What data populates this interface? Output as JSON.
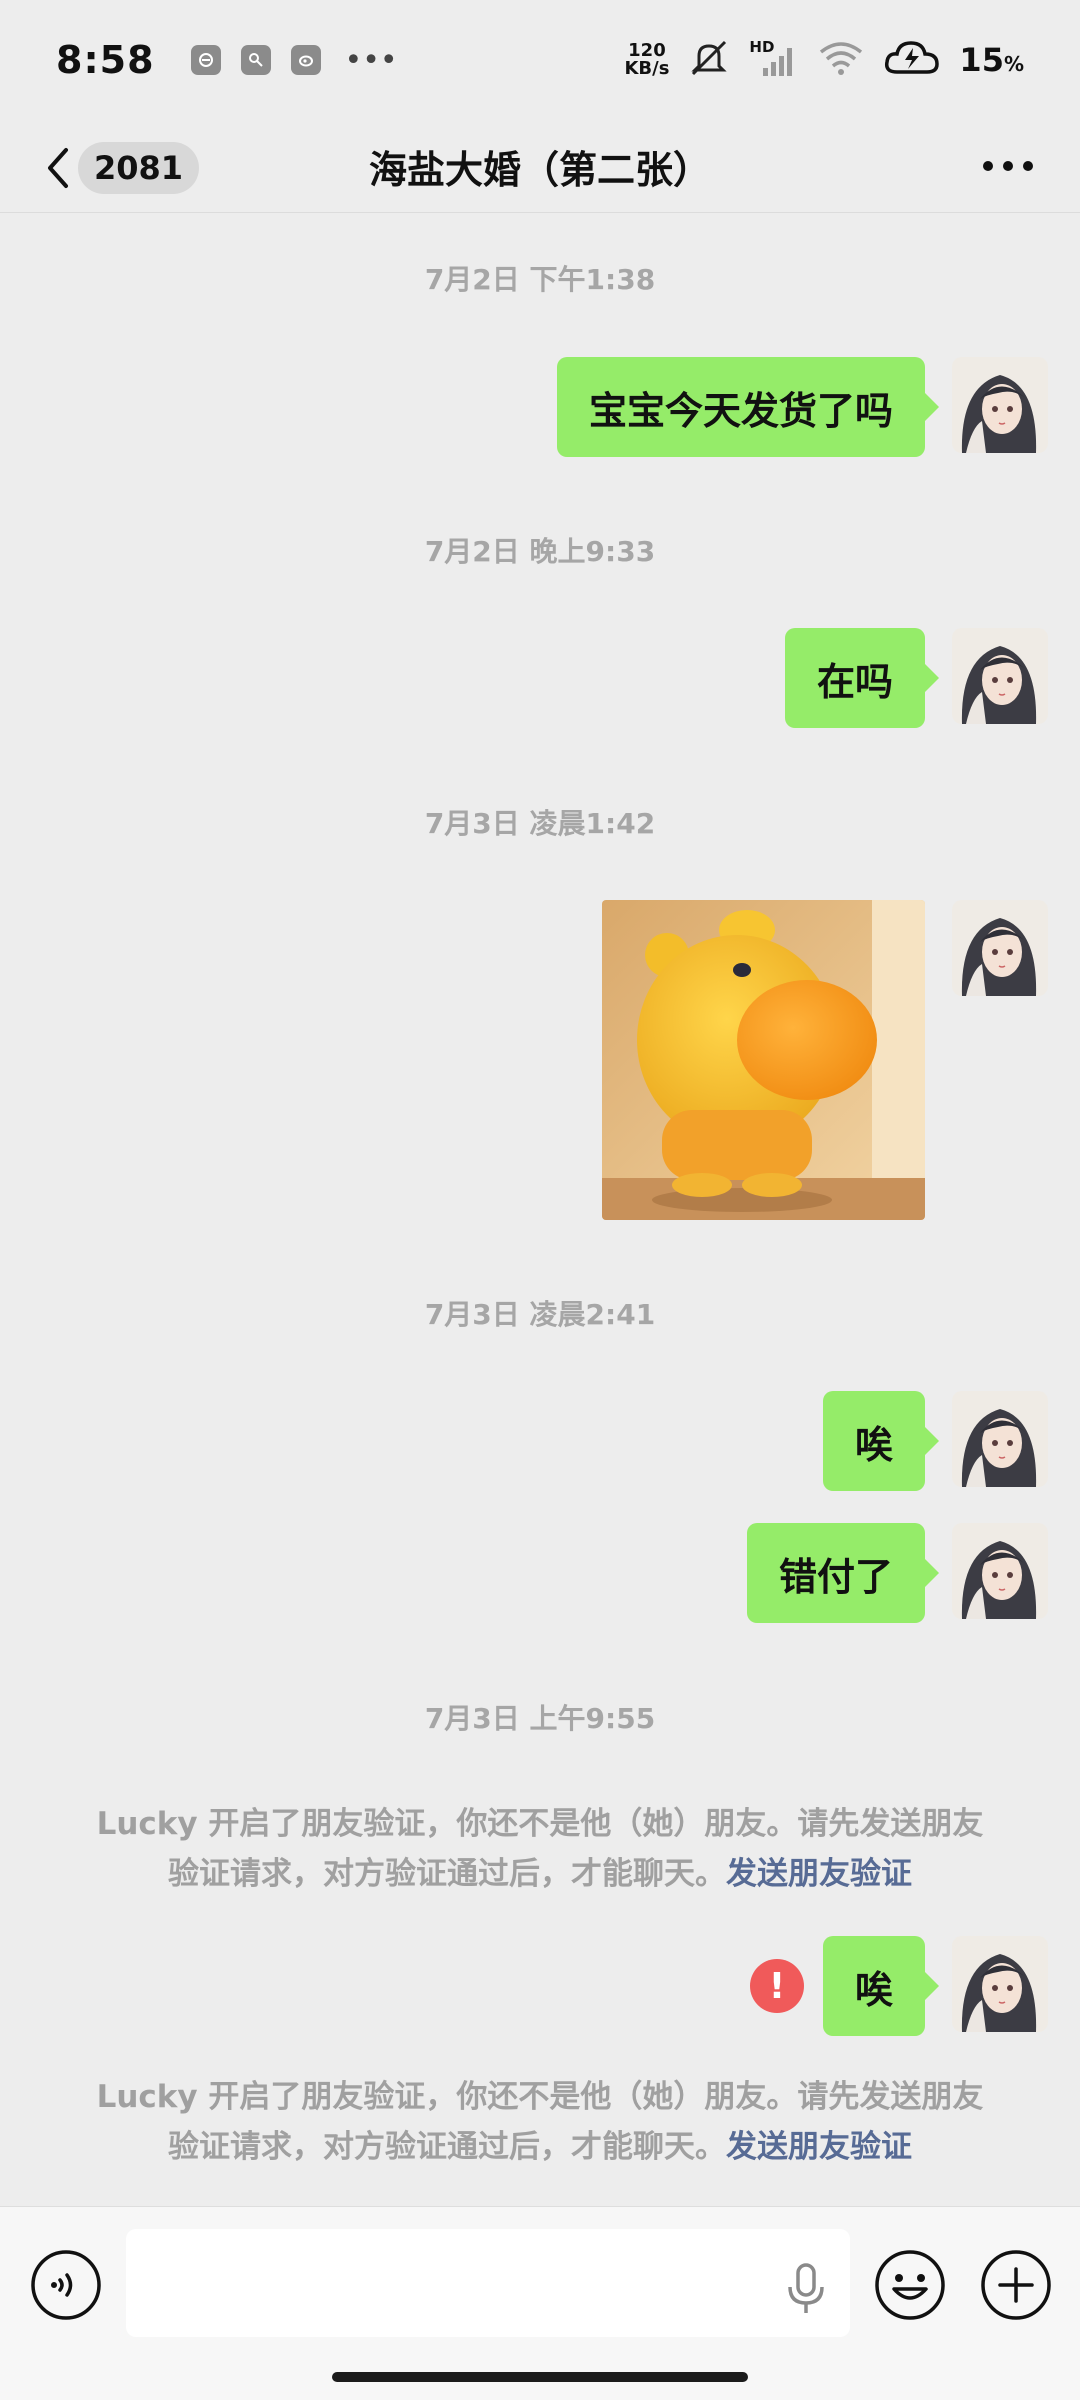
{
  "status_bar": {
    "time": "8:58",
    "speed_value": "120",
    "speed_unit": "KB/s",
    "signal_label": "HD",
    "battery_value": "15",
    "battery_unit": "%"
  },
  "header": {
    "unread_count": "2081",
    "title": "海盐大婚（第二张）"
  },
  "messages": [
    {
      "type": "timestamp",
      "text": "7月2日 下午1:38"
    },
    {
      "type": "sent_text",
      "text": "宝宝今天发货了吗"
    },
    {
      "type": "timestamp",
      "text": "7月2日 晚上9:33"
    },
    {
      "type": "sent_text",
      "text": "在吗"
    },
    {
      "type": "timestamp",
      "text": "7月3日 凌晨1:42"
    },
    {
      "type": "sent_image",
      "text": ""
    },
    {
      "type": "timestamp",
      "text": "7月3日 凌晨2:41"
    },
    {
      "type": "sent_text",
      "text": "唉"
    },
    {
      "type": "sent_text",
      "text": "错付了"
    },
    {
      "type": "timestamp",
      "text": "7月3日 上午9:55"
    },
    {
      "type": "system",
      "line1": "Lucky 开启了朋友验证，你还不是他（她）朋友。请先发送朋友",
      "line2": "验证请求，对方验证通过后，才能聊天。",
      "link": "发送朋友验证"
    },
    {
      "type": "sent_text_failed",
      "text": "唉",
      "error_mark": "!"
    },
    {
      "type": "system",
      "line1": "Lucky 开启了朋友验证，你还不是他（她）朋友。请先发送朋友",
      "line2": "验证请求，对方验证通过后，才能聊天。",
      "link": "发送朋友验证"
    }
  ],
  "input": {
    "value": "",
    "placeholder": ""
  },
  "colors": {
    "background": "#ededed",
    "bubble_sent": "#95ec69",
    "system_text": "#a0a0a0",
    "link": "#576b95",
    "error": "#f05a5a"
  },
  "icons": {
    "back": "chevron-left-icon",
    "more": "more-dots-icon",
    "voice": "voice-icon",
    "mic": "mic-icon",
    "emoji": "emoji-icon",
    "plus": "plus-icon"
  }
}
